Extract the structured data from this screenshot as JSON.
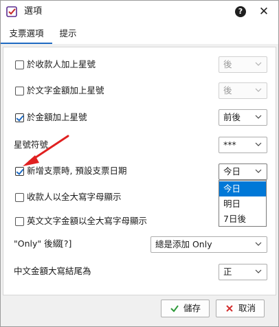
{
  "window": {
    "title": "選項",
    "help_label": "?",
    "close_label": "✕"
  },
  "tabs": [
    {
      "label": "支票選項",
      "active": true
    },
    {
      "label": "提示",
      "active": false
    }
  ],
  "options": {
    "payee_star": {
      "label": "於收款人加上星號",
      "checked": false,
      "select_value": "後",
      "enabled": false
    },
    "words_star": {
      "label": "於文字金額加上星號",
      "checked": false,
      "select_value": "後",
      "enabled": false
    },
    "amount_star": {
      "label": "於金額加上星號",
      "checked": true,
      "select_value": "前後",
      "enabled": true
    },
    "star_symbol": {
      "label": "星號符號",
      "select_value": "***"
    },
    "default_date": {
      "label": "新增支票時, 預設支票日期",
      "checked": true,
      "select_value": "今日"
    },
    "payee_upper": {
      "label": "收款人以全大寫字母顯示",
      "checked": false
    },
    "english_upper": {
      "label": "英文文字金額以全大寫字母顯示",
      "checked": false
    },
    "only_suffix": {
      "label": "\"Only\" 後綴",
      "hint": "[?]",
      "select_value": "總是添加 Only"
    },
    "chinese_end": {
      "label": "中文金額大寫結尾為",
      "select_value": "正"
    }
  },
  "date_dropdown": {
    "items": [
      {
        "label": "今日",
        "selected": true
      },
      {
        "label": "明日",
        "selected": false
      },
      {
        "label": "7日後",
        "selected": false
      }
    ]
  },
  "buttons": {
    "save_label": "儲存",
    "cancel_label": "取消"
  },
  "colors": {
    "accent": "#0078d7",
    "check": "#1e6ac2",
    "arrow": "#e02020",
    "cancel_icon": "#d32f2f",
    "save_icon": "#2e9a3a"
  }
}
